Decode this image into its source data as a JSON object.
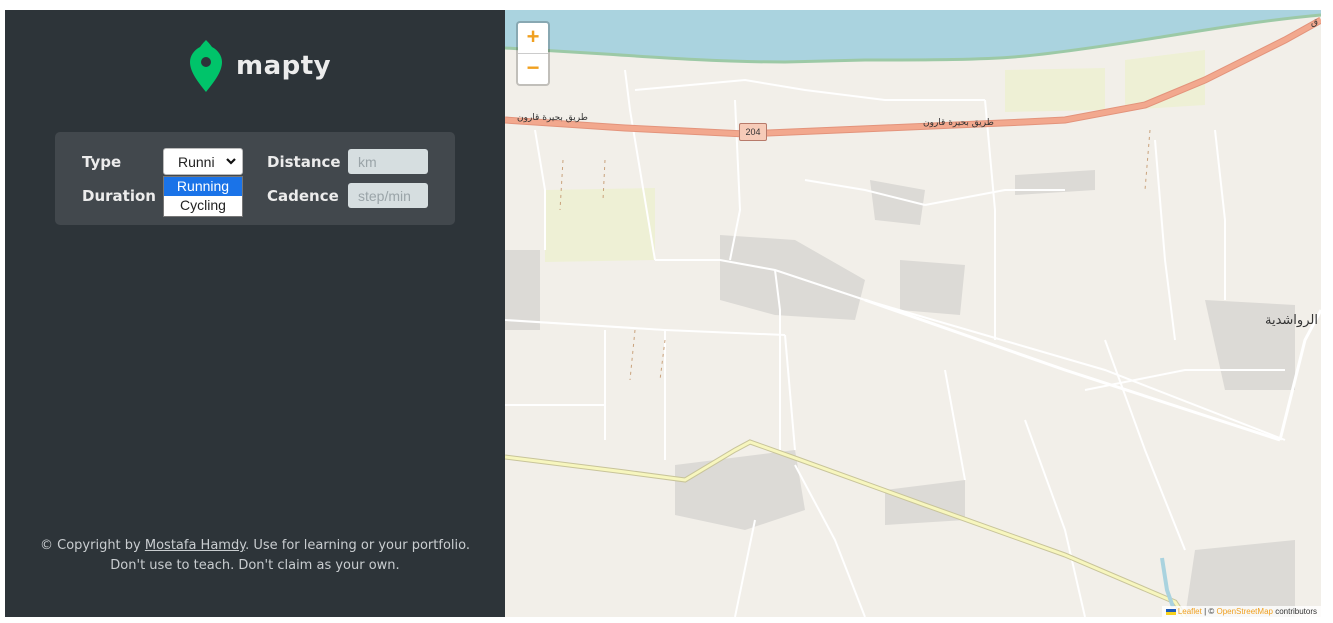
{
  "app": {
    "brand": "mapty",
    "brand_color": "#00c46a"
  },
  "form": {
    "type_label": "Type",
    "type_value": "Runni",
    "type_options": [
      "Running",
      "Cycling"
    ],
    "selected_option": "Running",
    "distance_label": "Distance",
    "distance_placeholder": "km",
    "duration_label": "Duration",
    "cadence_label": "Cadence",
    "cadence_placeholder": "step/min"
  },
  "footer": {
    "copyright_prefix": "© Copyright by ",
    "author": "Mostafa Hamdy",
    "copyright_suffix": ". Use for learning or your portfolio.",
    "line2": "Don't use to teach. Don't claim as your own."
  },
  "map": {
    "zoom_in": "+",
    "zoom_out": "−",
    "road_ref": "204",
    "road_name_1": "طريق بحيرة قارون",
    "road_name_2": "طريق بحيرة قارون",
    "town_name": "الرواشدية",
    "town_name_2": "ق",
    "attribution_leaflet": "Leaflet",
    "attribution_sep": " | © ",
    "attribution_osm": "OpenStreetMap",
    "attribution_suffix": " contributors"
  }
}
